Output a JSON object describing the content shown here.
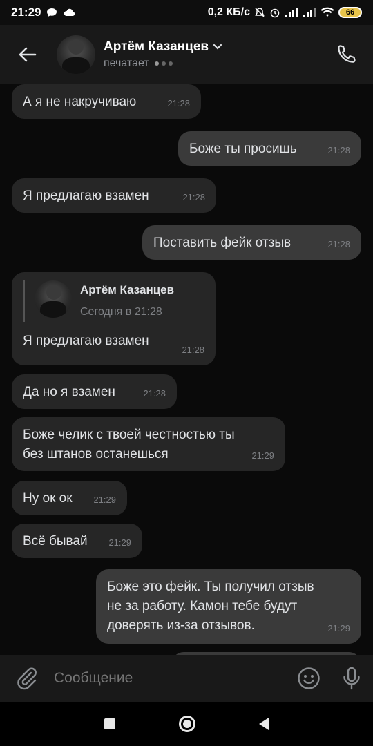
{
  "status": {
    "time": "21:29",
    "speed": "0,2 КБ/с",
    "battery": "66"
  },
  "header": {
    "name": "Артём Казанцев",
    "status": "печатает"
  },
  "messages": [
    {
      "dir": "in",
      "text": "А я не накручиваю",
      "time": "21:28"
    },
    {
      "dir": "out",
      "text": "Боже ты просишь",
      "time": "21:28"
    },
    {
      "dir": "in",
      "text": "Я предлагаю взамен",
      "time": "21:28"
    },
    {
      "dir": "out",
      "text": "Поставить фейк отзыв",
      "time": "21:28"
    },
    {
      "dir": "in",
      "reply": {
        "name": "Артём Казанцев",
        "date": "Сегодня в 21:28"
      },
      "text": "Я предлагаю взамен",
      "time": "21:28"
    },
    {
      "dir": "in",
      "text": "Да но я взамен",
      "time": "21:28"
    },
    {
      "dir": "in",
      "text": "Боже челик с твоей честностью ты\nбез штанов останешься",
      "time": "21:29"
    },
    {
      "dir": "in",
      "text": "Ну ок ок",
      "time": "21:29"
    },
    {
      "dir": "in",
      "text": "Всё бывай",
      "time": "21:29"
    },
    {
      "dir": "out",
      "text": "Боже это фейк. Ты получил отзыв\nне за работу. Камон тебе будут\nдоверять из-за отзывов.",
      "time": "21:29"
    }
  ],
  "composer": {
    "placeholder": "Сообщение"
  },
  "icons": {
    "back": "arrow-left-icon",
    "dropdown": "chevron-down-icon",
    "call": "phone-icon",
    "attach": "paperclip-icon",
    "emoji": "smile-icon",
    "mic": "microphone-icon"
  },
  "colors": {
    "background": "#0a0a0a",
    "bar": "#191919",
    "bubble_in": "#262626",
    "bubble_out": "#3a3a3a",
    "text": "#e1e3e6",
    "secondary": "#7d7f83"
  }
}
